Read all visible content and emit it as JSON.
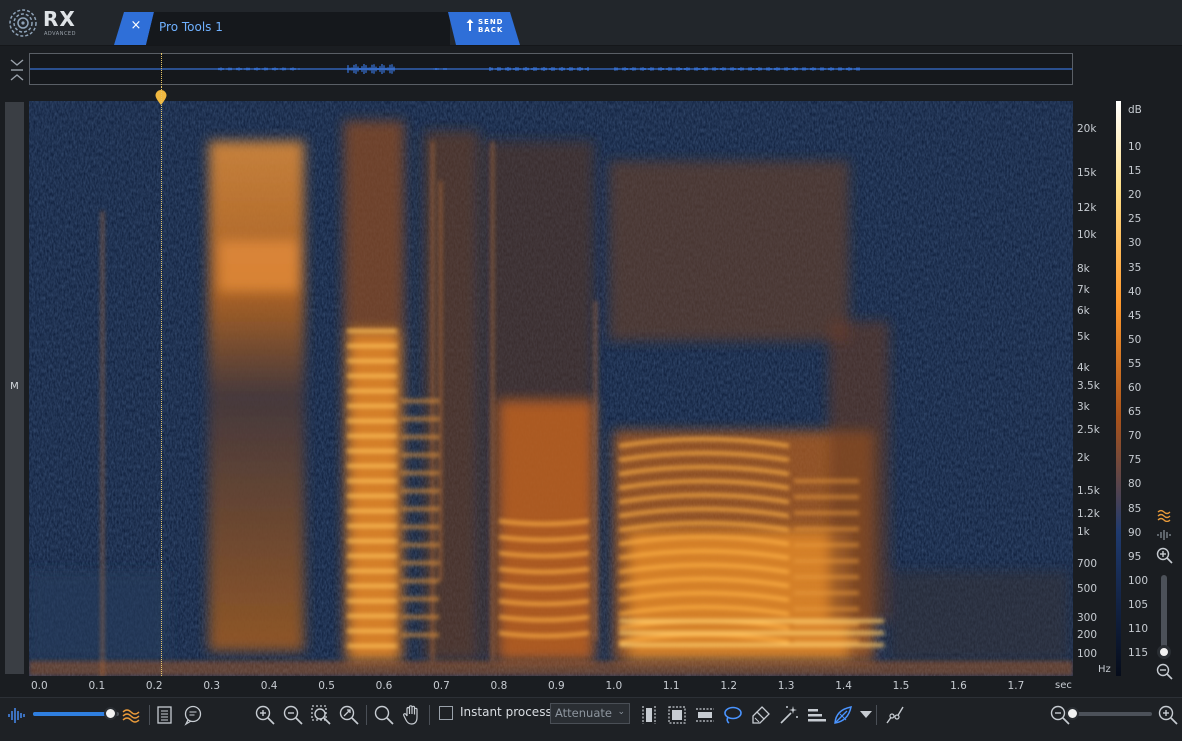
{
  "app": {
    "logo_text": "RX",
    "logo_subtext": "ADVANCED"
  },
  "tab": {
    "label": "Pro Tools 1",
    "close_glyph": "×",
    "send_back_line1": "SEND",
    "send_back_line2": "BACK"
  },
  "colors": {
    "accent": "#2f6fd8",
    "tab_text": "#6fb1ff",
    "spectro_background": "#0b1a36",
    "spectro_hot": "#ffb347",
    "playhead": "#e6c466",
    "waveform": "#3f86ff"
  },
  "playhead": {
    "time_sec": 0.23
  },
  "channel": {
    "label": "M"
  },
  "frequency_axis": {
    "ticks": [
      "20k",
      "15k",
      "12k",
      "10k",
      "8k",
      "7k",
      "6k",
      "5k",
      "4k",
      "3.5k",
      "3k",
      "2.5k",
      "2k",
      "1.5k",
      "1.2k",
      "1k",
      "700",
      "500",
      "300",
      "200",
      "100"
    ],
    "unit": "Hz"
  },
  "db_axis": {
    "label": "dB",
    "ticks": [
      "10",
      "15",
      "20",
      "25",
      "30",
      "35",
      "40",
      "45",
      "50",
      "55",
      "60",
      "65",
      "70",
      "75",
      "80",
      "85",
      "90",
      "95",
      "100",
      "105",
      "110",
      "115"
    ]
  },
  "time_axis": {
    "ticks": [
      "0.0",
      "0.1",
      "0.2",
      "0.3",
      "0.4",
      "0.5",
      "0.6",
      "0.7",
      "0.8",
      "0.9",
      "1.0",
      "1.1",
      "1.2",
      "1.3",
      "1.4",
      "1.5",
      "1.6",
      "1.7"
    ],
    "unit": "sec"
  },
  "toolbar": {
    "opacity_slider_value": 0.9,
    "instant_process_label": "Instant process",
    "instant_process_checked": false,
    "mode_value": "Attenuate",
    "zoom_slider_value": 0.0
  },
  "icons": {
    "waveform_view": "waveform-icon",
    "spectrogram_view": "spectrogram-icon",
    "edit_history": "history-list-icon",
    "comments": "comment-icon",
    "zoom_in": "zoom-in-icon",
    "zoom_out": "zoom-out-icon",
    "zoom_selection": "zoom-selection-icon",
    "zoom_fit": "zoom-fit-icon",
    "magnify": "magnify-icon",
    "hand": "hand-icon",
    "time_select": "time-select-icon",
    "freq_select": "frequency-select-icon",
    "rect_select": "rectangle-select-icon",
    "lasso": "lasso-icon",
    "brush": "brush-icon",
    "magic_wand": "magic-wand-icon",
    "harmonic": "harmonic-select-icon",
    "gain": "gain-icon",
    "dropdown": "dropdown-arrow-icon",
    "curve": "curve-icon"
  }
}
